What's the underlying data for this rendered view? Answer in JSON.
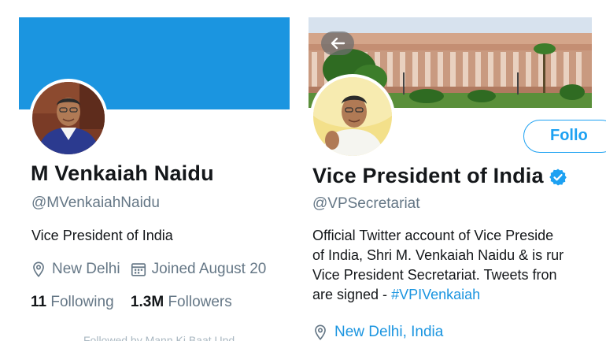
{
  "left_profile": {
    "name": "M Venkaiah Naidu",
    "handle": "@MVenkaiahNaidu",
    "bio": "Vice President of India",
    "location": "New Delhi",
    "joined": "Joined August 20",
    "following_count": "11",
    "following_label": "Following",
    "followers_count": "1.3M",
    "followers_label": "Followers",
    "followed_by": "Followed by Mann Ki Baat Upd",
    "banner_color": "#1b95e0"
  },
  "right_profile": {
    "name": "Vice President of India",
    "handle": "@VPSecretariat",
    "bio_lines": [
      "Official Twitter account of Vice Preside",
      "of India, Shri M. Venkaiah Naidu & is rur",
      "Vice President Secretariat. Tweets fron"
    ],
    "bio_last_prefix": "are signed - ",
    "bio_hashtag": "#VPIVenkaiah",
    "location": "New Delhi, India",
    "follow_label": "Follo",
    "verified": true,
    "accent_color": "#1da1f2"
  },
  "icons": {
    "location": "location-pin-icon",
    "joined": "calendar-icon",
    "back": "back-arrow-icon",
    "verified": "verified-badge-icon"
  }
}
